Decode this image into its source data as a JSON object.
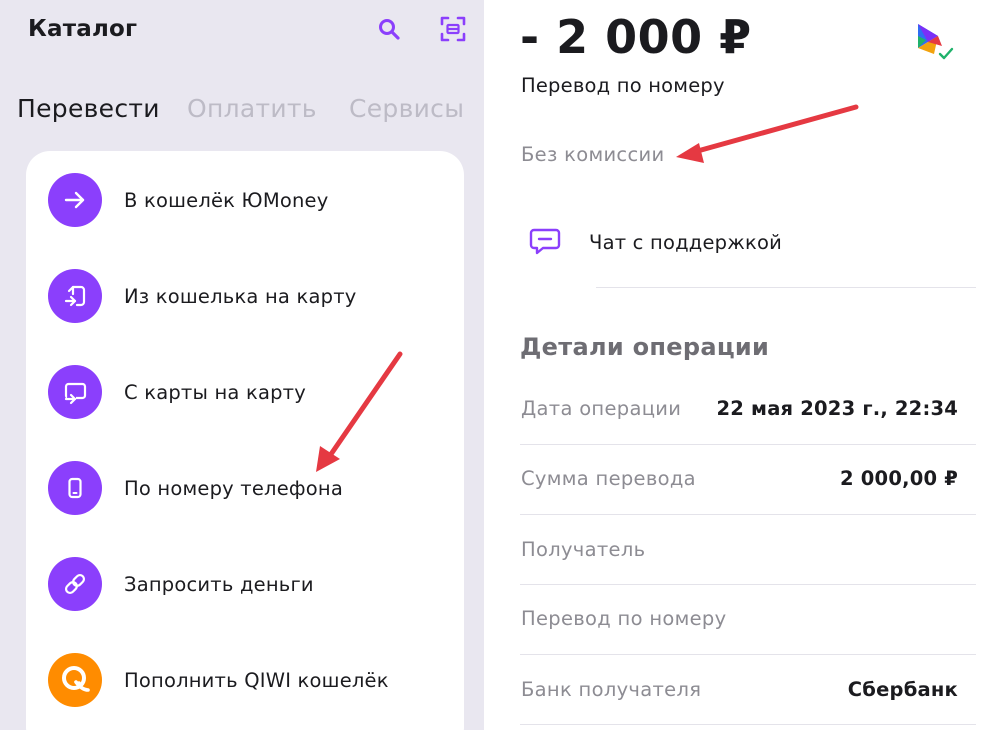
{
  "catalog": {
    "title": "Каталог",
    "tabs": [
      "Перевести",
      "Оплатить",
      "Сервисы"
    ],
    "items": [
      {
        "label": "В кошелёк ЮMoney",
        "icon": "arrow-right-icon"
      },
      {
        "label": "Из кошелька на карту",
        "icon": "wallet-to-card-icon"
      },
      {
        "label": "С карты на карту",
        "icon": "card-to-card-icon"
      },
      {
        "label": "По номеру телефона",
        "icon": "phone-icon"
      },
      {
        "label": "Запросить деньги",
        "icon": "link-icon"
      },
      {
        "label": "Пополнить QIWI кошелёк",
        "icon": "qiwi-logo-icon"
      }
    ]
  },
  "operation": {
    "amount": "- 2 000 ₽",
    "type": "Перевод по номеру",
    "commission": "Без комиссии",
    "chat_label": "Чат с поддержкой",
    "details_title": "Детали операции",
    "details": [
      {
        "label": "Дата операции",
        "value": "22 мая 2023 г., 22:34"
      },
      {
        "label": "Сумма перевода",
        "value": "2 000,00 ₽"
      },
      {
        "label": "Получатель",
        "value": ""
      },
      {
        "label": "Перевод по номеру",
        "value": ""
      },
      {
        "label": "Банк получателя",
        "value": "Сбербанк"
      }
    ]
  },
  "colors": {
    "accent": "#8b3ffc",
    "qiwi": "#ff8c00",
    "annotation_arrow": "#e53942",
    "panel_bg": "#e9e7f0"
  }
}
